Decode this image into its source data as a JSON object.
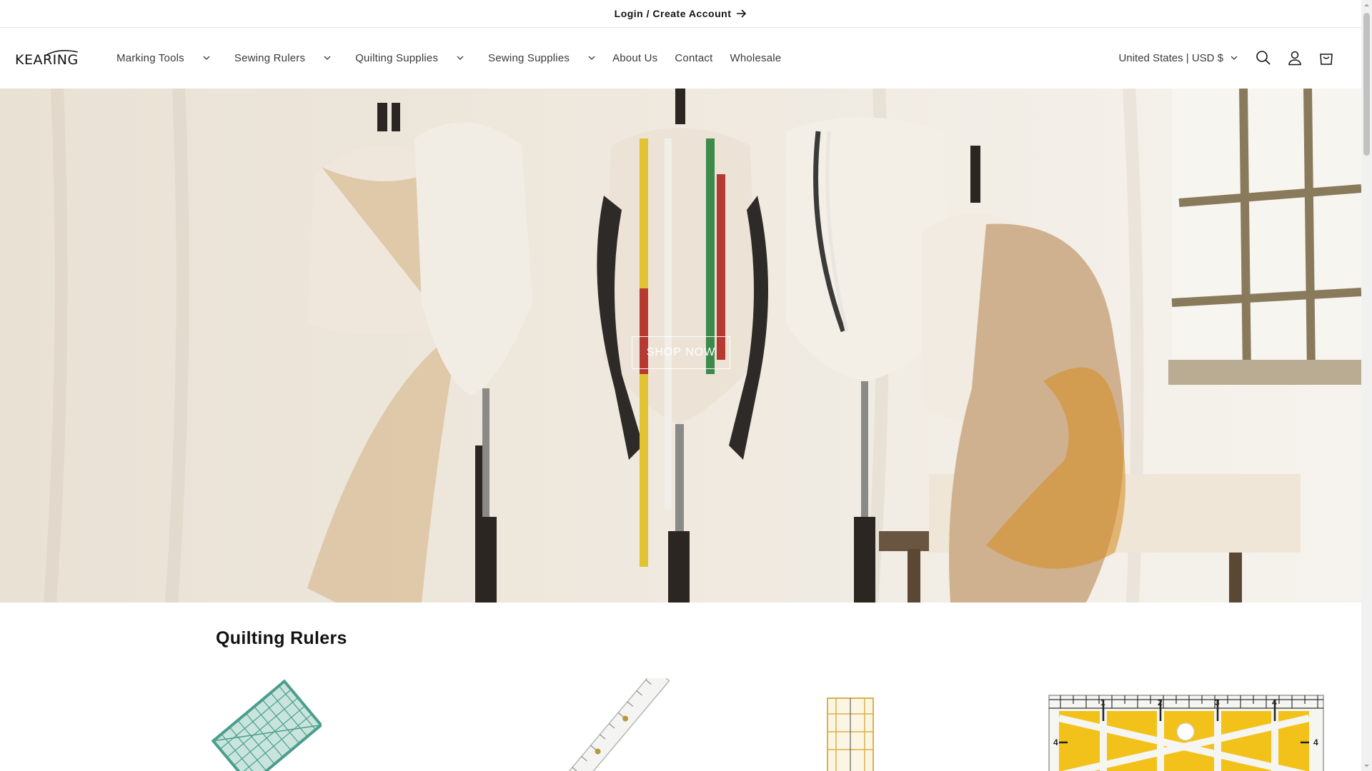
{
  "announcement": {
    "text": "Login / Create Account"
  },
  "header": {
    "logo_text": "KEARING",
    "nav": [
      {
        "label": "Marking Tools",
        "dropdown": true
      },
      {
        "label": "Sewing Rulers",
        "dropdown": true
      },
      {
        "label": "Quilting Supplies",
        "dropdown": true
      },
      {
        "label": "Sewing Supplies",
        "dropdown": true
      },
      {
        "label": "About Us",
        "dropdown": false
      },
      {
        "label": "Contact",
        "dropdown": false
      },
      {
        "label": "Wholesale",
        "dropdown": false
      }
    ],
    "country_selector": "United States | USD $",
    "icons": [
      "search-icon",
      "account-icon",
      "cart-icon"
    ]
  },
  "hero": {
    "button_label": "SHOP NOW"
  },
  "section": {
    "title": "Quilting Rulers"
  },
  "colors": {
    "text": "#121212",
    "nav_text": "#3a3a3a",
    "ruler_teal": "#4a9e8e",
    "ruler_yellow": "#f2c21a"
  }
}
